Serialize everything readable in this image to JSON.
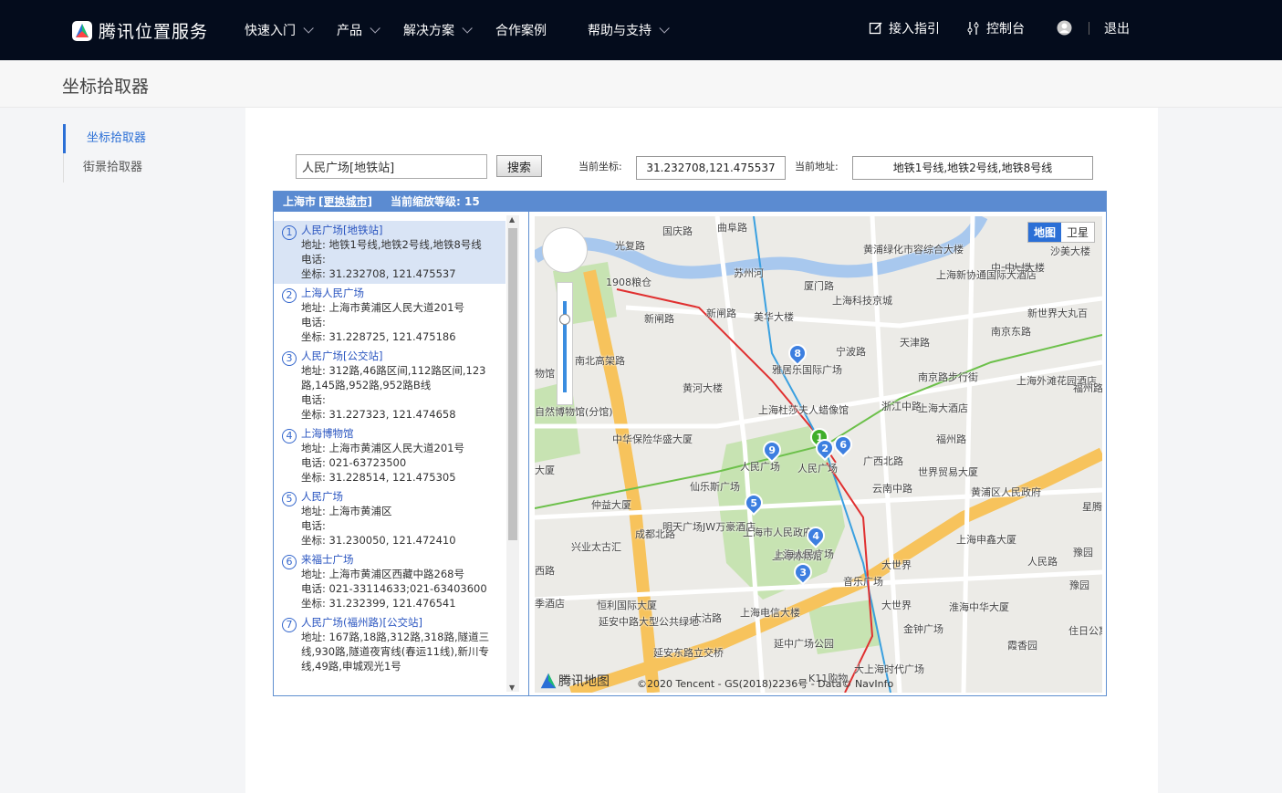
{
  "header": {
    "brand": "腾讯位置服务",
    "nav": [
      "快速入门",
      "产品",
      "解决方案",
      "合作案例",
      "帮助与支持"
    ],
    "guide": "接入指引",
    "console": "控制台",
    "logout": "退出"
  },
  "page_title": "坐标拾取器",
  "sidebar": {
    "items": [
      "坐标拾取器",
      "街景拾取器"
    ]
  },
  "search": {
    "value": "人民广场[地铁站]",
    "button": "搜索"
  },
  "coord": {
    "label": "当前坐标:",
    "value": "31.232708,121.475537"
  },
  "address": {
    "label": "当前地址:",
    "value": "地铁1号线,地铁2号线,地铁8号线"
  },
  "picker": {
    "city": "上海市",
    "change_city": "[更换城市]",
    "zoom": "当前缩放等级: 15"
  },
  "results": [
    {
      "num": "1",
      "name": "人民广场[地铁站]",
      "addr": "地址: 地铁1号线,地铁2号线,地铁8号线",
      "tel": "电话:",
      "coord": "坐标: 31.232708, 121.475537"
    },
    {
      "num": "2",
      "name": "上海人民广场",
      "addr": "地址: 上海市黄浦区人民大道201号",
      "tel": "电话:",
      "coord": "坐标: 31.228725, 121.475186"
    },
    {
      "num": "3",
      "name": "人民广场[公交站]",
      "addr": "地址: 312路,46路区间,112路区间,123路,145路,952路,952路B线",
      "tel": "电话:",
      "coord": "坐标: 31.227323, 121.474658"
    },
    {
      "num": "4",
      "name": "上海博物馆",
      "addr": "地址: 上海市黄浦区人民大道201号",
      "tel": "电话: 021-63723500",
      "coord": "坐标: 31.228514, 121.475305"
    },
    {
      "num": "5",
      "name": "人民广场",
      "addr": "地址: 上海市黄浦区",
      "tel": "电话:",
      "coord": "坐标: 31.230050, 121.472410"
    },
    {
      "num": "6",
      "name": "来福士广场",
      "addr": "地址: 上海市黄浦区西藏中路268号",
      "tel": "电话: 021-33114633;021-63403600",
      "coord": "坐标: 31.232399, 121.476541"
    },
    {
      "num": "7",
      "name": "人民广场(福州路)[公交站]",
      "addr": "地址: 167路,18路,312路,318路,隧道三线,930路,隧道夜宵线(春运11线),新川专线,49路,申城观光1号",
      "tel": "",
      "coord": ""
    }
  ],
  "map": {
    "toggle_map": "地图",
    "toggle_sat": "卫星",
    "logo": "腾讯地图",
    "credit": "©2020 Tencent - GS(2018)2236号 - Data© NavInfo",
    "labels": [
      "曲阜路",
      "国庆路",
      "光复路",
      "苏州河",
      "黄浦绿化市容综合大楼",
      "中一大楼",
      "沙美大楼",
      "1908粮仓",
      "厦门路",
      "上海新协通国际大酒店",
      "新世界大丸百",
      "新闸路",
      "新闸路",
      "美华大楼",
      "上海科技京城",
      "南京东路",
      "南北高架路",
      "宁波路",
      "天津路",
      "雅居乐国际广场",
      "南京路步行街",
      "上海外滩花园酒店",
      "福州路",
      "黄河大楼",
      "上海杜莎夫人蜡像馆",
      "浙江中路",
      "上海大酒店",
      "中华保险华盛大厦",
      "人民广场",
      "人民广场",
      "广西北路",
      "福州路",
      "世界贸易大厦",
      "云南中路",
      "仙乐斯广场",
      "黄浦区人民政府",
      "星腾",
      "仲益大厦",
      "上海市人民政府",
      "成都北路",
      "明天广场JW万豪酒店",
      "兴业太古汇",
      "上海博物馆",
      "上海人民广场",
      "大世界",
      "上海申鑫大厦",
      "人民路",
      "豫园",
      "豫园",
      "音乐广场",
      "恒利国际大厦",
      "大世界",
      "淮海中华大厦",
      "上海电信大楼",
      "大沽路",
      "延安中路大型公共绿地",
      "金钟广场",
      "住日公寓",
      "延中广场公园",
      "霞香园",
      "延安东路立交桥",
      "大上海时代广场",
      "K11购物",
      "物馆",
      "自然博物馆(分馆)",
      "西路",
      "大厦",
      "季酒店",
      "中一大楼"
    ],
    "markers": [
      "1",
      "2",
      "3",
      "4",
      "5",
      "6",
      "8",
      "9"
    ]
  }
}
